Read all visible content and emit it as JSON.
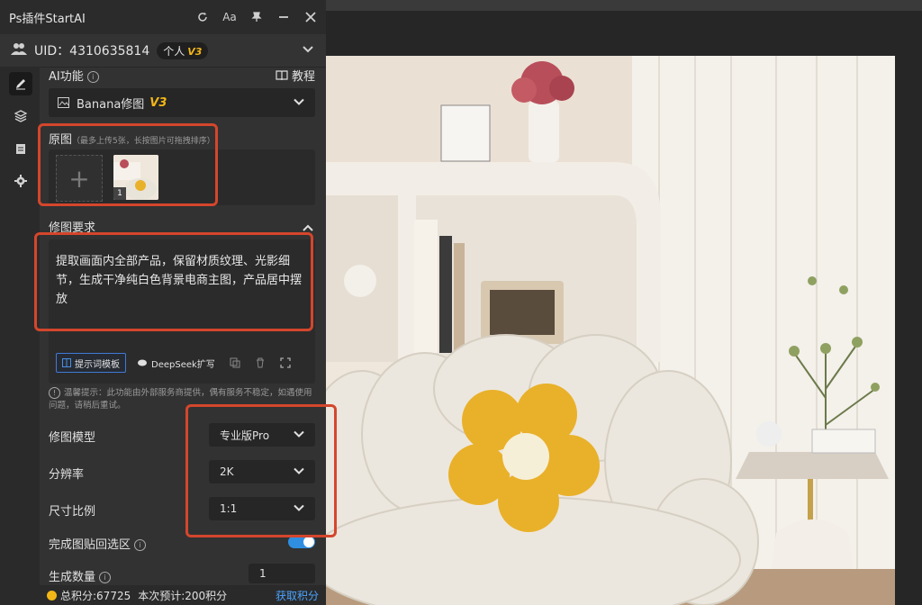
{
  "window": {
    "title": "Ps插件StartAI"
  },
  "titlebar_icons": [
    "refresh-icon",
    "font-size-icon",
    "pin-icon",
    "minimize-icon",
    "close-icon"
  ],
  "font_icon_text": "Aa",
  "account": {
    "uid_label": "UID：4310635814",
    "plan": "个人",
    "version": "V3"
  },
  "ai_function": {
    "label": "AI功能",
    "tutorial": "教程",
    "selected": "Banana修图",
    "version": "V3"
  },
  "original": {
    "label": "原图",
    "hint": "（最多上传5张，长按图片可拖拽排序）",
    "thumb_index": "1"
  },
  "requirement": {
    "label": "修图要求",
    "text": "提取画面内全部产品，保留材质纹理、光影细节，生成干净纯白色背景电商主图，产品居中摆放",
    "template_btn": "提示词模板",
    "deepseek_btn": "DeepSeek扩写"
  },
  "tip": "温馨提示：此功能由外部服务商提供，偶有服务不稳定，如遇使用问题，请稍后重试。",
  "settings": {
    "model_label": "修图模型",
    "model_value": "专业版Pro",
    "resolution_label": "分辨率",
    "resolution_value": "2K",
    "ratio_label": "尺寸比例",
    "ratio_value": "1:1",
    "paste_back_label": "完成图贴回选区",
    "paste_back_on": true,
    "count_label": "生成数量",
    "count_value": "1"
  },
  "footer": {
    "total_points": "总积分:67725",
    "estimate": "本次预计:200积分",
    "get_points": "获取积分"
  },
  "colors": {
    "accent": "#2f8ee0",
    "badge": "#f2b616",
    "highlight": "#d4462c"
  }
}
